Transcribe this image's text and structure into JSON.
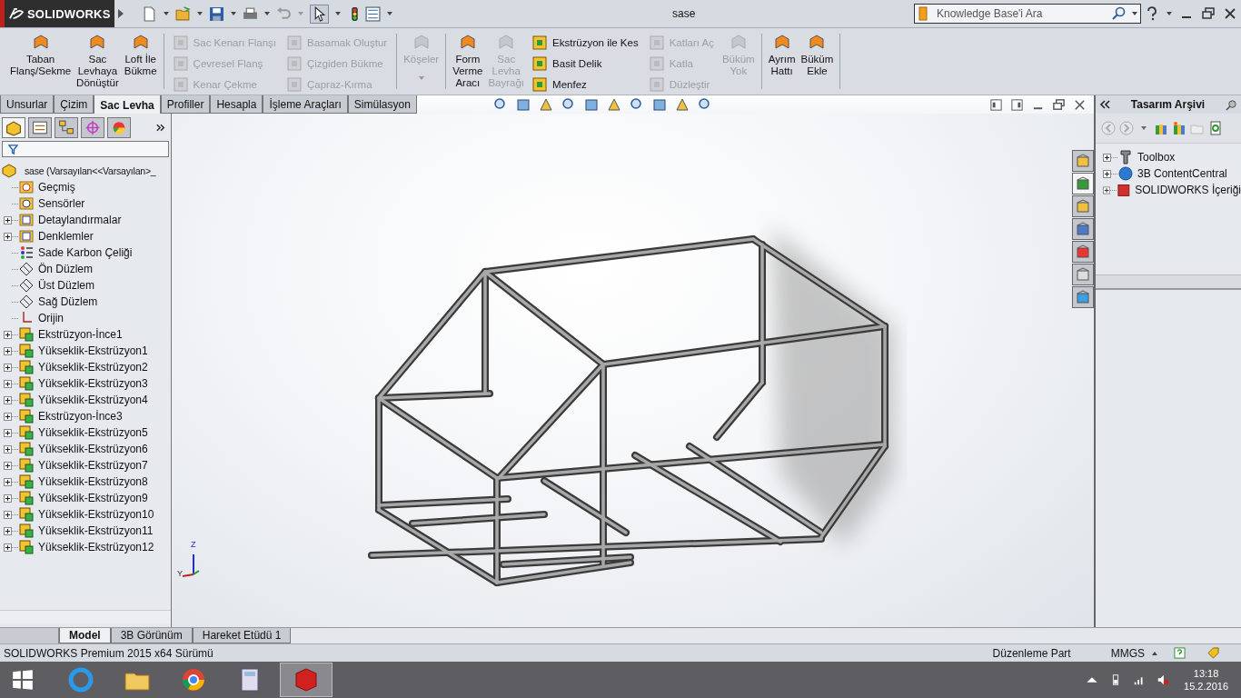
{
  "titlebar": {
    "logo": "SOLIDWORKS",
    "document": "sase",
    "search": {
      "placeholder": "Knowledge Base'i Ara"
    }
  },
  "ribbon": {
    "groups": [
      {
        "columns": [
          {
            "kind": "large",
            "items": [
              {
                "label": "Taban\nFlanş/Sekme",
                "disabled": false
              }
            ]
          },
          {
            "kind": "large",
            "items": [
              {
                "label": "Sac\nLevhaya\nDönüştür",
                "disabled": false
              }
            ]
          },
          {
            "kind": "large",
            "items": [
              {
                "label": "Loft İle\nBükme",
                "disabled": false
              }
            ]
          }
        ]
      },
      {
        "columns": [
          {
            "kind": "stack",
            "items": [
              {
                "label": "Sac Kenarı Flanşı",
                "disabled": true
              },
              {
                "label": "Çevresel Flanş",
                "disabled": true
              },
              {
                "label": "Kenar Çekme",
                "disabled": true
              }
            ]
          },
          {
            "kind": "stack",
            "items": [
              {
                "label": "Basamak Oluştur",
                "disabled": true
              },
              {
                "label": "Çizgiden Bükme",
                "disabled": true
              },
              {
                "label": "Çapraz-Kırma",
                "disabled": true
              }
            ]
          }
        ]
      },
      {
        "columns": [
          {
            "kind": "large",
            "dropdown": true,
            "items": [
              {
                "label": "Köşeler",
                "disabled": true
              }
            ]
          }
        ]
      },
      {
        "columns": [
          {
            "kind": "large",
            "items": [
              {
                "label": "Form\nVerme\nAracı",
                "disabled": false
              }
            ]
          },
          {
            "kind": "large",
            "items": [
              {
                "label": "Sac\nLevha\nBayrağı",
                "disabled": true
              }
            ]
          },
          {
            "kind": "stack",
            "items": [
              {
                "label": "Ekstrüzyon ile Kes",
                "disabled": false
              },
              {
                "label": "Basit Delik",
                "disabled": false
              },
              {
                "label": "Menfez",
                "disabled": false
              }
            ]
          },
          {
            "kind": "stack",
            "items": [
              {
                "label": "Katları Aç",
                "disabled": true
              },
              {
                "label": "Katla",
                "disabled": true
              },
              {
                "label": "Düzleştir",
                "disabled": true
              }
            ]
          },
          {
            "kind": "large",
            "items": [
              {
                "label": "Büküm\nYok",
                "disabled": true
              }
            ]
          }
        ]
      },
      {
        "columns": [
          {
            "kind": "large",
            "items": [
              {
                "label": "Ayrım\nHattı",
                "disabled": false
              }
            ]
          },
          {
            "kind": "large",
            "items": [
              {
                "label": "Büküm\nEkle",
                "disabled": false
              }
            ]
          }
        ]
      }
    ]
  },
  "command_tabs": [
    {
      "label": "Unsurlar",
      "selected": false
    },
    {
      "label": "Çizim",
      "selected": false
    },
    {
      "label": "Sac Levha",
      "selected": true
    },
    {
      "label": "Profiller",
      "selected": false
    },
    {
      "label": "Hesapla",
      "selected": false
    },
    {
      "label": "İşleme Araçları",
      "selected": false
    },
    {
      "label": "Simülasyon",
      "selected": false
    }
  ],
  "feature_tree": {
    "root": "sase  (Varsayılan<<Varsayılan>_",
    "items": [
      {
        "label": "Geçmiş",
        "kind": "history"
      },
      {
        "label": "Sensörler",
        "kind": "sensor"
      },
      {
        "label": "Detaylandırmalar",
        "kind": "annotation",
        "expanded": false
      },
      {
        "label": "Denklemler",
        "kind": "equation",
        "expanded": false
      },
      {
        "label": "Sade Karbon Çeliği",
        "kind": "material"
      },
      {
        "label": "Ön Düzlem",
        "kind": "plane"
      },
      {
        "label": "Üst Düzlem",
        "kind": "plane"
      },
      {
        "label": "Sağ Düzlem",
        "kind": "plane"
      },
      {
        "label": "Orijin",
        "kind": "origin"
      },
      {
        "label": "Ekstrüzyon-İnce1",
        "kind": "feature",
        "expanded": false
      },
      {
        "label": "Yükseklik-Ekstrüzyon1",
        "kind": "feature",
        "expanded": false
      },
      {
        "label": "Yükseklik-Ekstrüzyon2",
        "kind": "feature",
        "expanded": false
      },
      {
        "label": "Yükseklik-Ekstrüzyon3",
        "kind": "feature",
        "expanded": false
      },
      {
        "label": "Yükseklik-Ekstrüzyon4",
        "kind": "feature",
        "expanded": false
      },
      {
        "label": "Ekstrüzyon-İnce3",
        "kind": "feature",
        "expanded": false
      },
      {
        "label": "Yükseklik-Ekstrüzyon5",
        "kind": "feature",
        "expanded": false
      },
      {
        "label": "Yükseklik-Ekstrüzyon6",
        "kind": "feature",
        "expanded": false
      },
      {
        "label": "Yükseklik-Ekstrüzyon7",
        "kind": "feature",
        "expanded": false
      },
      {
        "label": "Yükseklik-Ekstrüzyon8",
        "kind": "feature",
        "expanded": false
      },
      {
        "label": "Yükseklik-Ekstrüzyon9",
        "kind": "feature",
        "expanded": false
      },
      {
        "label": "Yükseklik-Ekstrüzyon10",
        "kind": "feature",
        "expanded": false
      },
      {
        "label": "Yükseklik-Ekstrüzyon11",
        "kind": "feature",
        "expanded": false
      },
      {
        "label": "Yükseklik-Ekstrüzyon12",
        "kind": "feature",
        "expanded": false
      }
    ]
  },
  "viewport": {
    "triad": [
      "Z",
      "Y"
    ]
  },
  "task_pane": {
    "title": "Tasarım Arşivi",
    "items": [
      {
        "label": "Toolbox",
        "kind": "toolbox",
        "expanded": false
      },
      {
        "label": "3B ContentCentral",
        "kind": "globe",
        "expanded": false
      },
      {
        "label": "SOLIDWORKS İçeriği",
        "kind": "content",
        "expanded": false
      }
    ]
  },
  "bottom_tabs": [
    {
      "label": "Model",
      "selected": true
    },
    {
      "label": "3B Görünüm",
      "selected": false
    },
    {
      "label": "Hareket Etüdü 1",
      "selected": false
    }
  ],
  "status_bar": {
    "text": "SOLIDWORKS Premium 2015 x64 Sürümü",
    "mode": "Düzenleme Part",
    "units": "MMGS"
  },
  "taskbar": {
    "apps": [
      {
        "kind": "ie",
        "active": false
      },
      {
        "kind": "explorer",
        "active": false
      },
      {
        "kind": "chrome",
        "active": false
      },
      {
        "kind": "calculator",
        "active": false
      },
      {
        "kind": "solidworks",
        "active": true
      }
    ],
    "time": "13:18",
    "date": "15.2.2016"
  }
}
